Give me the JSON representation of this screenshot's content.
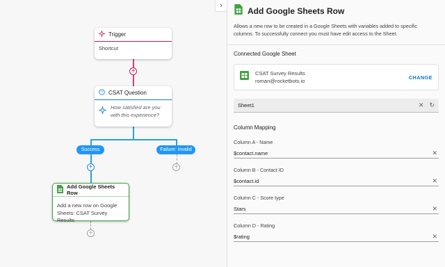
{
  "canvas": {
    "collapse_icon": "chevron-right-icon",
    "nodes": {
      "trigger": {
        "title": "Trigger",
        "body": "Shortcut",
        "icon": "sparkle-icon",
        "accent": "#c2185b"
      },
      "csat": {
        "title": "CSAT Question",
        "body": "How satisfied are you with this experience?",
        "icon": "help-circle-icon",
        "body_icon": "sparkle-icon",
        "accent": "#1976d2"
      },
      "gsheet": {
        "title": "Add Google Sheets Row",
        "body": "Add a new row on Google Sheets: CSAT Survey Results",
        "icon": "google-sheets-icon",
        "accent": "#43a047"
      }
    },
    "branches": {
      "success": "Success",
      "failure": "Failure: Invalid"
    }
  },
  "panel": {
    "title": "Add Google Sheets Row",
    "description": "Allows a new row to be created in a Google Sheets with variables added to specific columns. To successfully connect you must have edit access to the Sheet.",
    "connected_title": "Connected Google Sheet",
    "connected": {
      "name": "CSAT Survey Results",
      "account": "roman@rocketbots.io",
      "change_label": "CHANGE"
    },
    "sheet": {
      "value": "Sheet1"
    },
    "mapping_title": "Column Mapping",
    "columns": [
      {
        "label": "Column A - Name",
        "value": "$contact.name"
      },
      {
        "label": "Column B - Contact ID",
        "value": "$contact.id"
      },
      {
        "label": "Column C - Score type",
        "value": "Stars"
      },
      {
        "label": "Column D - Rating",
        "value": "$rating"
      }
    ]
  },
  "colors": {
    "trigger": "#c2185b",
    "question": "#1976d2",
    "branch": "#2196f3",
    "sheets_green": "#43a047",
    "link_blue": "#1976d2"
  }
}
